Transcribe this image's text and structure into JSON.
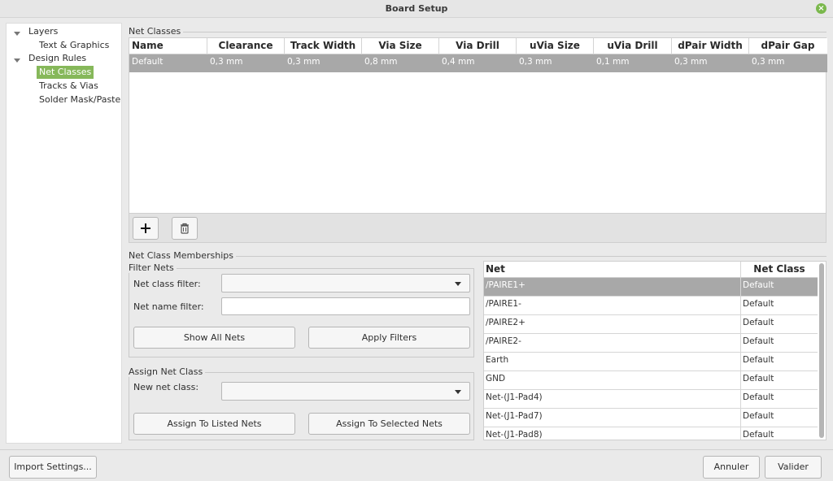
{
  "window": {
    "title": "Board Setup"
  },
  "tree": [
    {
      "label": "Layers",
      "level": 0,
      "expanded": true
    },
    {
      "label": "Text & Graphics",
      "level": 1
    },
    {
      "label": "Design Rules",
      "level": 0,
      "expanded": true
    },
    {
      "label": "Net Classes",
      "level": 1,
      "selected": true
    },
    {
      "label": "Tracks & Vias",
      "level": 1
    },
    {
      "label": "Solder Mask/Paste",
      "level": 1
    }
  ],
  "net_classes": {
    "group_label": "Net Classes",
    "columns": [
      "Name",
      "Clearance",
      "Track Width",
      "Via Size",
      "Via Drill",
      "uVia Size",
      "uVia Drill",
      "dPair Width",
      "dPair Gap"
    ],
    "rows": [
      [
        "Default",
        "0,3 mm",
        "0,3 mm",
        "0,8 mm",
        "0,4 mm",
        "0,3 mm",
        "0,1 mm",
        "0,3 mm",
        "0,3 mm"
      ]
    ],
    "add_icon": "plus-icon",
    "delete_icon": "trash-icon"
  },
  "memberships": {
    "group_label": "Net Class Memberships",
    "filter": {
      "group_label": "Filter Nets",
      "net_class_filter_label": "Net class filter:",
      "net_class_filter_value": "",
      "net_name_filter_label": "Net name filter:",
      "net_name_filter_value": "",
      "show_all_label": "Show All Nets",
      "apply_filters_label": "Apply Filters"
    },
    "assign": {
      "group_label": "Assign Net Class",
      "new_net_class_label": "New net class:",
      "new_net_class_value": "",
      "assign_listed_label": "Assign To Listed Nets",
      "assign_selected_label": "Assign To Selected Nets"
    },
    "nets": {
      "columns": [
        "Net",
        "Net Class"
      ],
      "rows": [
        {
          "net": "/PAIRE1+",
          "class": "Default",
          "selected": true
        },
        {
          "net": "/PAIRE1-",
          "class": "Default"
        },
        {
          "net": "/PAIRE2+",
          "class": "Default"
        },
        {
          "net": "/PAIRE2-",
          "class": "Default"
        },
        {
          "net": "Earth",
          "class": "Default"
        },
        {
          "net": "GND",
          "class": "Default"
        },
        {
          "net": "Net-(J1-Pad4)",
          "class": "Default"
        },
        {
          "net": "Net-(J1-Pad7)",
          "class": "Default"
        },
        {
          "net": "Net-(J1-Pad8)",
          "class": "Default"
        }
      ]
    }
  },
  "footer": {
    "import_label": "Import Settings...",
    "cancel_label": "Annuler",
    "ok_label": "Valider"
  },
  "colors": {
    "selection_green": "#86b85a",
    "row_selection_gray": "#a8a8a8",
    "close_button": "#7ab84c"
  }
}
